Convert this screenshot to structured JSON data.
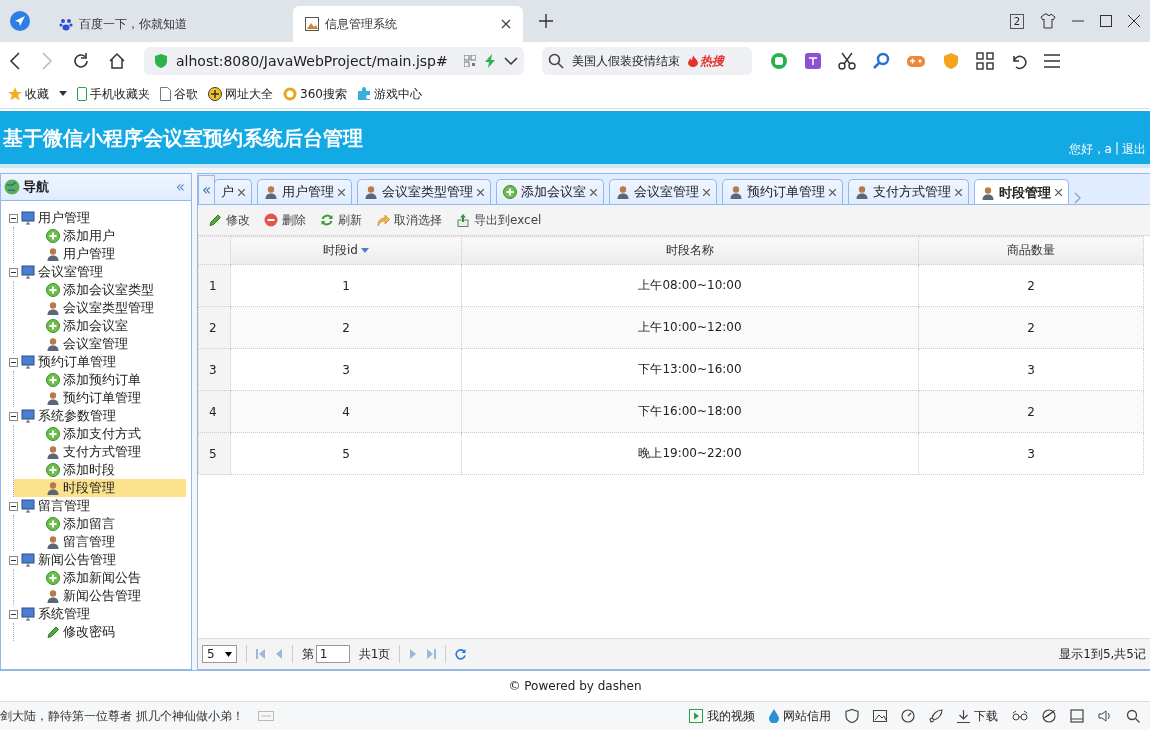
{
  "browser": {
    "tabs": [
      {
        "title": "百度一下，你就知道",
        "selected": false
      },
      {
        "title": "信息管理系统",
        "selected": true
      }
    ],
    "window_count": "2",
    "address": "alhost:8080/JavaWebProject/main.jsp#",
    "search": {
      "value": "美国人假装疫情结束",
      "badge": "热搜"
    },
    "bookmarks": [
      "收藏",
      "手机收藏夹",
      "谷歌",
      "网址大全",
      "360搜索",
      "游戏中心"
    ]
  },
  "header": {
    "title": "基于微信小程序会议室预约系统后台管理",
    "greeting": "您好，a",
    "separator": "|",
    "logout": "退出"
  },
  "nav": {
    "title": "导航",
    "collapse": "«",
    "tree": [
      {
        "label": "用户管理",
        "expanded": true,
        "children": [
          {
            "label": "添加用户",
            "kind": "add",
            "selected": false
          },
          {
            "label": "用户管理",
            "kind": "manage",
            "selected": false
          }
        ]
      },
      {
        "label": "会议室管理",
        "expanded": true,
        "children": [
          {
            "label": "添加会议室类型",
            "kind": "add",
            "selected": false
          },
          {
            "label": "会议室类型管理",
            "kind": "manage",
            "selected": false
          },
          {
            "label": "添加会议室",
            "kind": "add",
            "selected": false
          },
          {
            "label": "会议室管理",
            "kind": "manage",
            "selected": false
          }
        ]
      },
      {
        "label": "预约订单管理",
        "expanded": true,
        "children": [
          {
            "label": "添加预约订单",
            "kind": "add",
            "selected": false
          },
          {
            "label": "预约订单管理",
            "kind": "manage",
            "selected": false
          }
        ]
      },
      {
        "label": "系统参数管理",
        "expanded": true,
        "children": [
          {
            "label": "添加支付方式",
            "kind": "add",
            "selected": false
          },
          {
            "label": "支付方式管理",
            "kind": "manage",
            "selected": false
          },
          {
            "label": "添加时段",
            "kind": "add",
            "selected": false
          },
          {
            "label": "时段管理",
            "kind": "manage",
            "selected": true
          }
        ]
      },
      {
        "label": "留言管理",
        "expanded": true,
        "children": [
          {
            "label": "添加留言",
            "kind": "add",
            "selected": false
          },
          {
            "label": "留言管理",
            "kind": "manage",
            "selected": false
          }
        ]
      },
      {
        "label": "新闻公告管理",
        "expanded": true,
        "children": [
          {
            "label": "添加新闻公告",
            "kind": "add",
            "selected": false
          },
          {
            "label": "新闻公告管理",
            "kind": "manage",
            "selected": false
          }
        ]
      },
      {
        "label": "系统管理",
        "expanded": true,
        "children": [
          {
            "label": "修改密码",
            "kind": "edit",
            "selected": false
          }
        ]
      }
    ]
  },
  "tabs": {
    "scroll_left": "«",
    "items": [
      {
        "label": "户",
        "kind": "none",
        "selected": false
      },
      {
        "label": "用户管理",
        "kind": "manage",
        "selected": false
      },
      {
        "label": "会议室类型管理",
        "kind": "manage",
        "selected": false
      },
      {
        "label": "添加会议室",
        "kind": "add",
        "selected": false
      },
      {
        "label": "会议室管理",
        "kind": "manage",
        "selected": false
      },
      {
        "label": "预约订单管理",
        "kind": "manage",
        "selected": false
      },
      {
        "label": "支付方式管理",
        "kind": "manage",
        "selected": false
      },
      {
        "label": "时段管理",
        "kind": "manage",
        "selected": true
      }
    ]
  },
  "toolbar": [
    {
      "label": "修改",
      "kind": "edit"
    },
    {
      "label": "删除",
      "kind": "delete"
    },
    {
      "label": "刷新",
      "kind": "refresh"
    },
    {
      "label": "取消选择",
      "kind": "undo"
    },
    {
      "label": "导出到excel",
      "kind": "export"
    }
  ],
  "table": {
    "columns": [
      {
        "label": "时段id",
        "sorted": true
      },
      {
        "label": "时段名称",
        "sorted": false
      },
      {
        "label": "商品数量",
        "sorted": false
      }
    ],
    "rows": [
      {
        "number": "1",
        "cells": [
          "1",
          "上午08:00~10:00",
          "2"
        ]
      },
      {
        "number": "2",
        "cells": [
          "2",
          "上午10:00~12:00",
          "2"
        ]
      },
      {
        "number": "3",
        "cells": [
          "3",
          "下午13:00~16:00",
          "3"
        ]
      },
      {
        "number": "4",
        "cells": [
          "4",
          "下午16:00~18:00",
          "2"
        ]
      },
      {
        "number": "5",
        "cells": [
          "5",
          "晚上19:00~22:00",
          "3"
        ]
      }
    ]
  },
  "pager": {
    "page_size": "5",
    "page_label": "第",
    "page": "1",
    "total_pages": "共1页",
    "info": "显示1到5,共5记"
  },
  "footer": "© Powered by dashen",
  "status_bar": {
    "message": "剑大陆，静待第一位尊者 抓几个神仙做小弟！",
    "items": [
      "我的视频",
      "网站信用",
      "下载"
    ]
  }
}
